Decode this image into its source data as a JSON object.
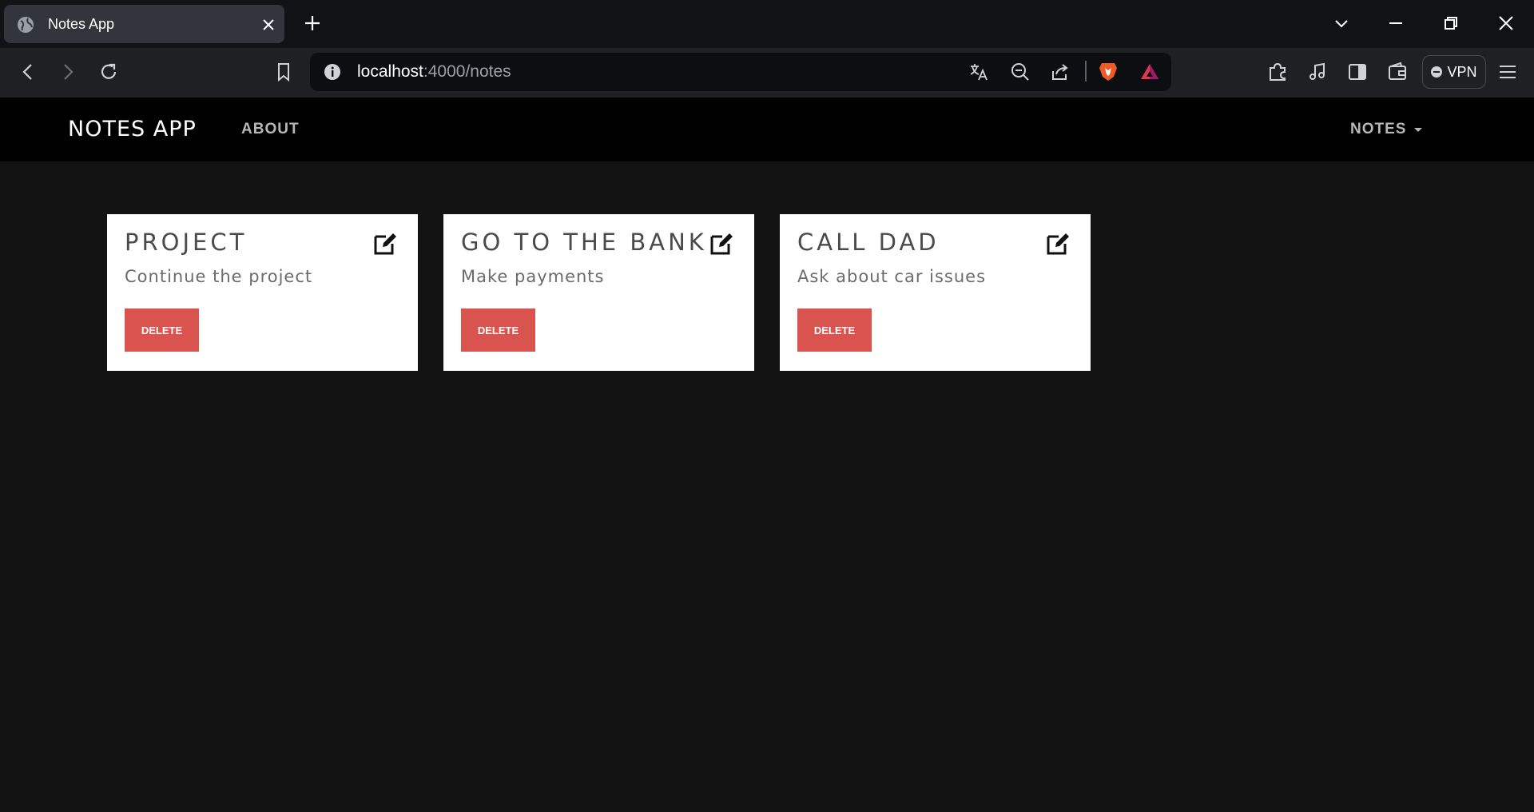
{
  "browser": {
    "tab_title": "Notes App",
    "url_host": "localhost",
    "url_path": ":4000/notes",
    "vpn_label": "VPN"
  },
  "icons": {
    "favicon": "globe-icon",
    "tab_close": "close-icon",
    "new_tab": "plus-icon",
    "tab_list": "chevron-down-icon",
    "minimize": "minimize-icon",
    "restore": "restore-icon",
    "close_window": "close-icon",
    "back": "arrow-left-icon",
    "forward": "arrow-right-icon",
    "reload": "reload-icon",
    "bookmark": "bookmark-icon",
    "site_info": "info-icon",
    "translate": "translate-icon",
    "zoom_out": "zoom-out-icon",
    "share": "share-icon",
    "brave_shields": "brave-lion-icon",
    "brave_rewards": "triangle-icon",
    "extensions": "puzzle-icon",
    "media": "music-note-icon",
    "sidebar": "sidebar-icon",
    "wallet": "wallet-icon",
    "menu": "hamburger-menu-icon",
    "card_edit": "edit-icon"
  },
  "colors": {
    "accent_delete": "#d9534f",
    "page_background": "#131313",
    "navbar_background": "#000000"
  },
  "navbar": {
    "brand": "NOTES APP",
    "about": "ABOUT",
    "notes": "NOTES"
  },
  "notes": [
    {
      "title": "PROJECT",
      "body": "Continue the project",
      "delete_label": "DELETE"
    },
    {
      "title": "GO TO THE BANK",
      "body": "Make payments",
      "delete_label": "DELETE"
    },
    {
      "title": "CALL DAD",
      "body": "Ask about car issues",
      "delete_label": "DELETE"
    }
  ]
}
